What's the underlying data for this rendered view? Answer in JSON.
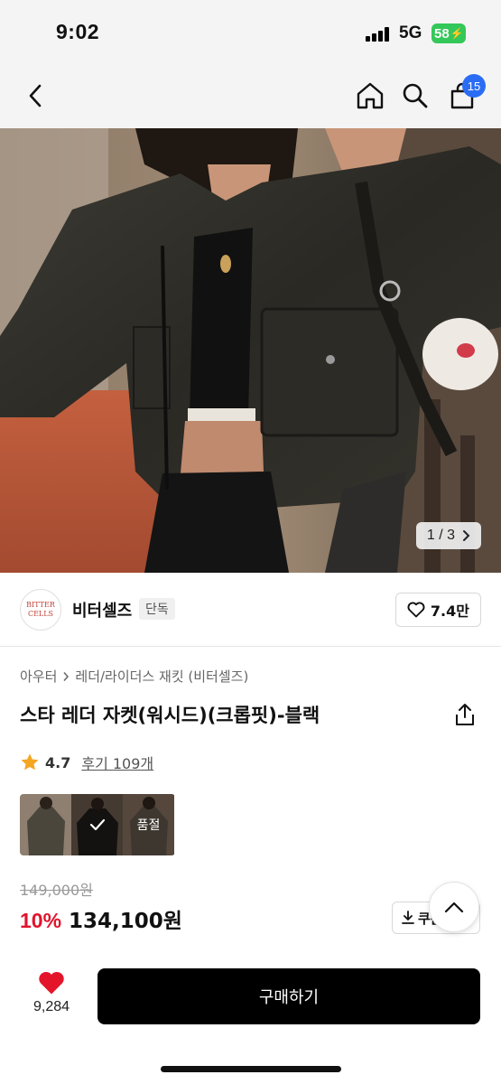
{
  "status_bar": {
    "time": "9:02",
    "network": "5G",
    "battery": "58"
  },
  "nav": {
    "cart_count": "15"
  },
  "hero": {
    "counter": "1 / 3"
  },
  "brand": {
    "logo_line1": "BITTER",
    "logo_line2": "CELLS",
    "name": "비터셀즈",
    "tag": "단독",
    "like_count": "7.4만"
  },
  "breadcrumb": {
    "level1": "아우터",
    "level2": "레더/라이더스 재킷 (비터셀즈)"
  },
  "product": {
    "title": "스타 레더 자켓(워시드)(크롭핏)-블랙"
  },
  "rating": {
    "score": "4.7",
    "reviews": "후기 109개"
  },
  "color_options": {
    "soldout_label": "품절"
  },
  "price": {
    "original": "149,000원",
    "discount": "10%",
    "sale": "134,100원",
    "coupon_label": "쿠폰"
  },
  "bottom": {
    "wish_count": "9,284",
    "buy_label": "구매하기"
  },
  "colors": {
    "accent_blue": "#2a6df4",
    "discount_red": "#e0142c",
    "heart_red": "#e4152b",
    "star_orange": "#f5a623",
    "battery_green": "#34c759"
  }
}
